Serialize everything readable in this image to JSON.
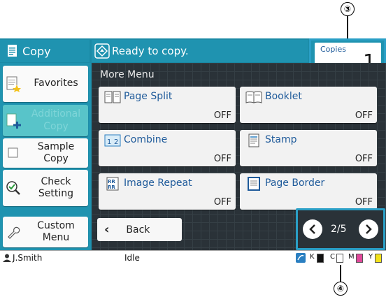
{
  "callouts": {
    "copies": "③",
    "pagination": "④"
  },
  "app": {
    "title": "Copy",
    "header_message": "Ready to copy."
  },
  "copies": {
    "label": "Copies",
    "value": "1"
  },
  "section": {
    "title": "More Menu"
  },
  "sidebar": {
    "items": [
      {
        "label": "Favorites",
        "icon": "favorites-icon"
      },
      {
        "label": "Additional Copy",
        "icon": "additional-copy-icon",
        "disabled": true
      },
      {
        "label": "Sample Copy",
        "icon": "checkbox-icon"
      },
      {
        "label": "Check Setting",
        "icon": "magnifier-check-icon"
      },
      {
        "label": "Custom Menu",
        "icon": "wrench-icon"
      }
    ]
  },
  "functions": [
    {
      "name": "Page Split",
      "state": "OFF",
      "icon": "page-split-icon"
    },
    {
      "name": "Booklet",
      "state": "OFF",
      "icon": "booklet-icon"
    },
    {
      "name": "Combine",
      "state": "OFF",
      "icon": "combine-icon"
    },
    {
      "name": "Stamp",
      "state": "OFF",
      "icon": "stamp-icon"
    },
    {
      "name": "Image Repeat",
      "state": "OFF",
      "icon": "image-repeat-icon"
    },
    {
      "name": "Page Border",
      "state": "OFF",
      "icon": "page-border-icon"
    }
  ],
  "back_button": {
    "label": "Back"
  },
  "pagination": {
    "text": "2/5"
  },
  "status_bar": {
    "user": "J.Smith",
    "status": "Idle",
    "inks": [
      {
        "label": "K",
        "color": "#111111"
      },
      {
        "label": "C",
        "color": "#ffffff"
      },
      {
        "label": "M",
        "color": "#e0489a"
      },
      {
        "label": "Y",
        "color": "#f2e21a"
      }
    ]
  },
  "colors": {
    "accent": "#1f93b0",
    "highlight_border": "#2a9fc6",
    "function_text": "#1e5a9a",
    "panel_bg": "#2a3238"
  }
}
